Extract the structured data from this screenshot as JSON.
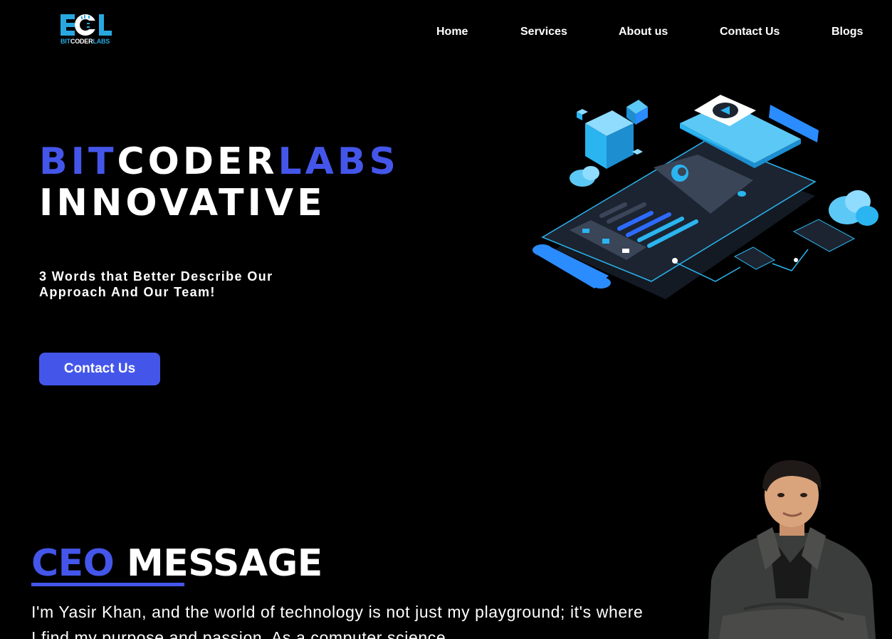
{
  "header": {
    "logo": {
      "letters": "BCL",
      "text_parts": [
        "BIT",
        "CODER",
        "LABS"
      ]
    },
    "nav": [
      "Home",
      "Services",
      "About us",
      "Contact Us",
      "Blogs"
    ]
  },
  "hero": {
    "title_line1": [
      "BIT",
      "CODER",
      "LABS"
    ],
    "title_line2": "INNOVATIVE",
    "subtitle": "3 Words that Better Describe Our Approach And Our Team!",
    "button_label": "Contact Us"
  },
  "ceo": {
    "title_accent": "CEO",
    "title_rest": "MESSAGE",
    "message": "I'm Yasir Khan, and the world of technology is not just my playground; it's where I find my purpose and passion. As a computer science"
  },
  "colors": {
    "accent": "#4456ea",
    "background": "#000000",
    "logo_blue": "#29a8e0",
    "illustration_blue": "#2bb5f0"
  },
  "icons": [
    "logo-icon",
    "isometric-app-illustration",
    "ceo-portrait"
  ]
}
